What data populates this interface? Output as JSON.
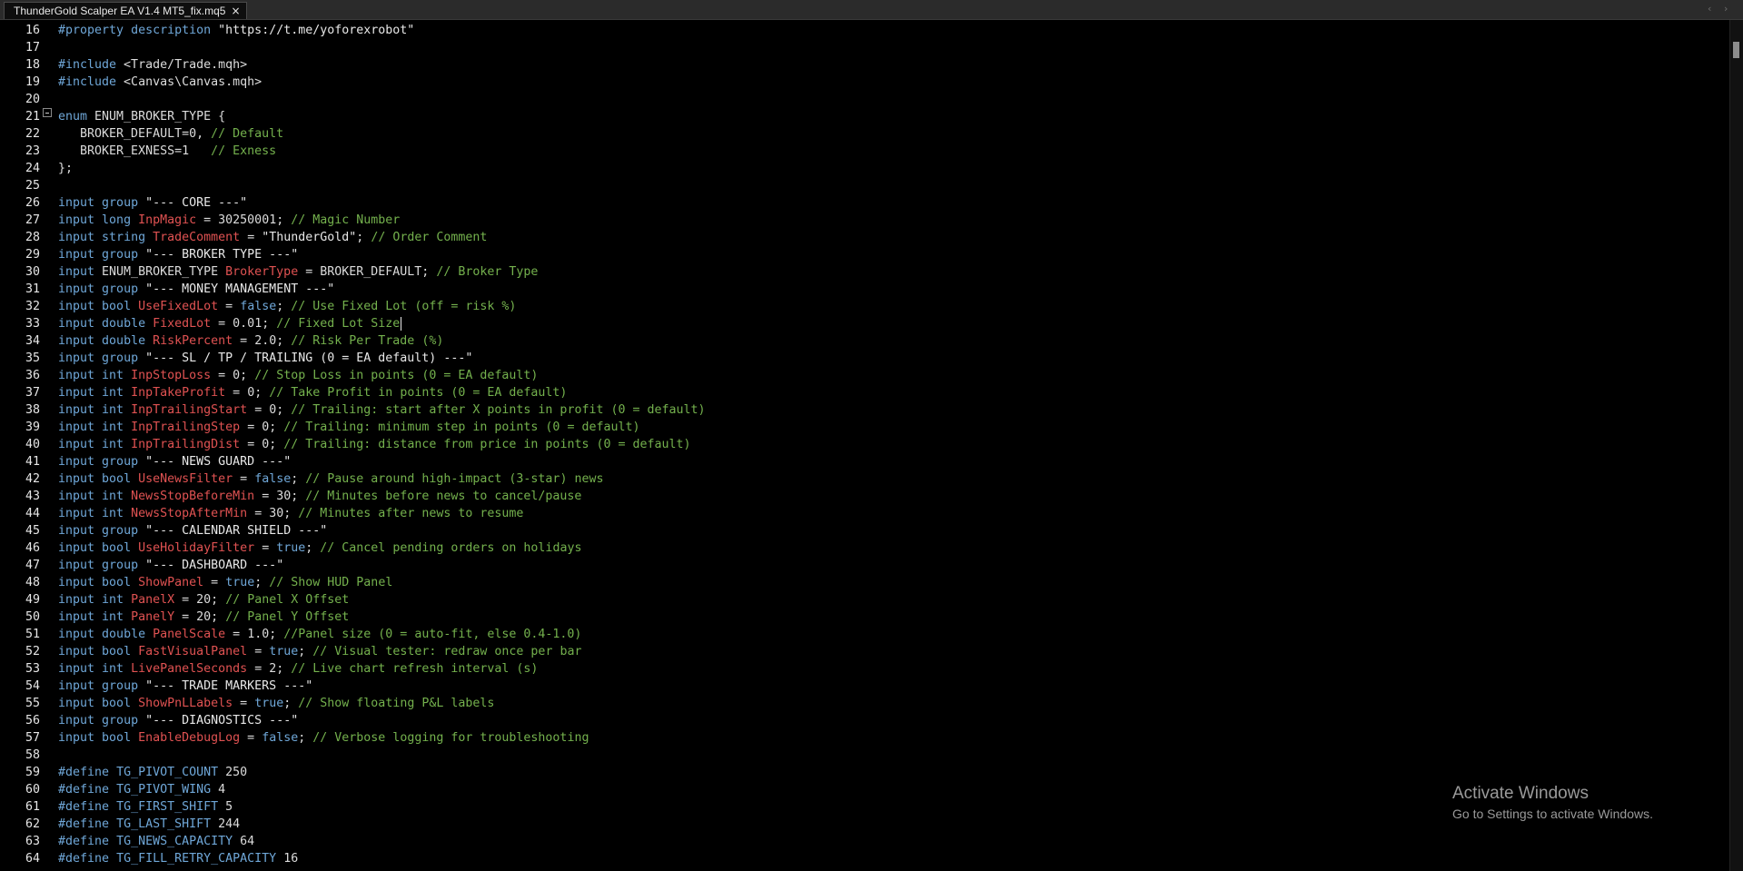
{
  "tab": {
    "title": "ThunderGold Scalper EA V1.4 MT5_fix.mq5",
    "close_icon": "×"
  },
  "nav": {
    "prev_icon": "‹",
    "next_icon": "›"
  },
  "watermark": {
    "title": "Activate Windows",
    "subtitle": "Go to Settings to activate Windows."
  },
  "code_lines": [
    {
      "n": "16",
      "t": [
        [
          "dir",
          "#property"
        ],
        [
          "pl",
          " "
        ],
        [
          "kw",
          "description"
        ],
        [
          "pl",
          " "
        ],
        [
          "str",
          "\"https://t.me/yoforexrobot\""
        ]
      ]
    },
    {
      "n": "17",
      "t": []
    },
    {
      "n": "18",
      "t": [
        [
          "dir",
          "#include"
        ],
        [
          "pl",
          " <Trade/Trade.mqh>"
        ]
      ]
    },
    {
      "n": "19",
      "t": [
        [
          "dir",
          "#include"
        ],
        [
          "pl",
          " <Canvas\\Canvas.mqh>"
        ]
      ]
    },
    {
      "n": "20",
      "t": []
    },
    {
      "n": "21",
      "t": [
        [
          "kw",
          "enum"
        ],
        [
          "pl",
          " ENUM_BROKER_TYPE {"
        ]
      ]
    },
    {
      "n": "22",
      "t": [
        [
          "pl",
          "   BROKER_DEFAULT=0, "
        ],
        [
          "cm",
          "// Default"
        ]
      ]
    },
    {
      "n": "23",
      "t": [
        [
          "pl",
          "   BROKER_EXNESS=1   "
        ],
        [
          "cm",
          "// Exness"
        ]
      ]
    },
    {
      "n": "24",
      "t": [
        [
          "pl",
          "};"
        ]
      ]
    },
    {
      "n": "25",
      "t": []
    },
    {
      "n": "26",
      "t": [
        [
          "kw",
          "input"
        ],
        [
          "pl",
          " "
        ],
        [
          "kw",
          "group"
        ],
        [
          "pl",
          " "
        ],
        [
          "str",
          "\"--- CORE ---\""
        ]
      ]
    },
    {
      "n": "27",
      "t": [
        [
          "kw",
          "input"
        ],
        [
          "pl",
          " "
        ],
        [
          "kw",
          "long"
        ],
        [
          "pl",
          " "
        ],
        [
          "var",
          "InpMagic"
        ],
        [
          "pl",
          " = 30250001; "
        ],
        [
          "cm",
          "// Magic Number"
        ]
      ]
    },
    {
      "n": "28",
      "t": [
        [
          "kw",
          "input"
        ],
        [
          "pl",
          " "
        ],
        [
          "kw",
          "string"
        ],
        [
          "pl",
          " "
        ],
        [
          "var",
          "TradeComment"
        ],
        [
          "pl",
          " = "
        ],
        [
          "str",
          "\"ThunderGold\""
        ],
        [
          "pl",
          "; "
        ],
        [
          "cm",
          "// Order Comment"
        ]
      ]
    },
    {
      "n": "29",
      "t": [
        [
          "kw",
          "input"
        ],
        [
          "pl",
          " "
        ],
        [
          "kw",
          "group"
        ],
        [
          "pl",
          " "
        ],
        [
          "str",
          "\"--- BROKER TYPE ---\""
        ]
      ]
    },
    {
      "n": "30",
      "t": [
        [
          "kw",
          "input"
        ],
        [
          "pl",
          " ENUM_BROKER_TYPE "
        ],
        [
          "var",
          "BrokerType"
        ],
        [
          "pl",
          " = BROKER_DEFAULT; "
        ],
        [
          "cm",
          "// Broker Type"
        ]
      ]
    },
    {
      "n": "31",
      "t": [
        [
          "kw",
          "input"
        ],
        [
          "pl",
          " "
        ],
        [
          "kw",
          "group"
        ],
        [
          "pl",
          " "
        ],
        [
          "str",
          "\"--- MONEY MANAGEMENT ---\""
        ]
      ]
    },
    {
      "n": "32",
      "t": [
        [
          "kw",
          "input"
        ],
        [
          "pl",
          " "
        ],
        [
          "kw",
          "bool"
        ],
        [
          "pl",
          " "
        ],
        [
          "var",
          "UseFixedLot"
        ],
        [
          "pl",
          " = "
        ],
        [
          "kw",
          "false"
        ],
        [
          "pl",
          "; "
        ],
        [
          "cm",
          "// Use Fixed Lot (off = risk %)"
        ]
      ]
    },
    {
      "n": "33",
      "t": [
        [
          "kw",
          "input"
        ],
        [
          "pl",
          " "
        ],
        [
          "kw",
          "double"
        ],
        [
          "pl",
          " "
        ],
        [
          "var",
          "FixedLot"
        ],
        [
          "pl",
          " = 0.01; "
        ],
        [
          "cm",
          "// Fixed Lot Size"
        ],
        [
          "caret",
          ""
        ]
      ]
    },
    {
      "n": "34",
      "t": [
        [
          "kw",
          "input"
        ],
        [
          "pl",
          " "
        ],
        [
          "kw",
          "double"
        ],
        [
          "pl",
          " "
        ],
        [
          "var",
          "RiskPercent"
        ],
        [
          "pl",
          " = 2.0; "
        ],
        [
          "cm",
          "// Risk Per Trade (%)"
        ]
      ]
    },
    {
      "n": "35",
      "t": [
        [
          "kw",
          "input"
        ],
        [
          "pl",
          " "
        ],
        [
          "kw",
          "group"
        ],
        [
          "pl",
          " "
        ],
        [
          "str",
          "\"--- SL / TP / TRAILING (0 = EA default) ---\""
        ]
      ]
    },
    {
      "n": "36",
      "t": [
        [
          "kw",
          "input"
        ],
        [
          "pl",
          " "
        ],
        [
          "kw",
          "int"
        ],
        [
          "pl",
          " "
        ],
        [
          "var",
          "InpStopLoss"
        ],
        [
          "pl",
          " = 0; "
        ],
        [
          "cm",
          "// Stop Loss in points (0 = EA default)"
        ]
      ]
    },
    {
      "n": "37",
      "t": [
        [
          "kw",
          "input"
        ],
        [
          "pl",
          " "
        ],
        [
          "kw",
          "int"
        ],
        [
          "pl",
          " "
        ],
        [
          "var",
          "InpTakeProfit"
        ],
        [
          "pl",
          " = 0; "
        ],
        [
          "cm",
          "// Take Profit in points (0 = EA default)"
        ]
      ]
    },
    {
      "n": "38",
      "t": [
        [
          "kw",
          "input"
        ],
        [
          "pl",
          " "
        ],
        [
          "kw",
          "int"
        ],
        [
          "pl",
          " "
        ],
        [
          "var",
          "InpTrailingStart"
        ],
        [
          "pl",
          " = 0; "
        ],
        [
          "cm",
          "// Trailing: start after X points in profit (0 = default)"
        ]
      ]
    },
    {
      "n": "39",
      "t": [
        [
          "kw",
          "input"
        ],
        [
          "pl",
          " "
        ],
        [
          "kw",
          "int"
        ],
        [
          "pl",
          " "
        ],
        [
          "var",
          "InpTrailingStep"
        ],
        [
          "pl",
          " = 0; "
        ],
        [
          "cm",
          "// Trailing: minimum step in points (0 = default)"
        ]
      ]
    },
    {
      "n": "40",
      "t": [
        [
          "kw",
          "input"
        ],
        [
          "pl",
          " "
        ],
        [
          "kw",
          "int"
        ],
        [
          "pl",
          " "
        ],
        [
          "var",
          "InpTrailingDist"
        ],
        [
          "pl",
          " = 0; "
        ],
        [
          "cm",
          "// Trailing: distance from price in points (0 = default)"
        ]
      ]
    },
    {
      "n": "41",
      "t": [
        [
          "kw",
          "input"
        ],
        [
          "pl",
          " "
        ],
        [
          "kw",
          "group"
        ],
        [
          "pl",
          " "
        ],
        [
          "str",
          "\"--- NEWS GUARD ---\""
        ]
      ]
    },
    {
      "n": "42",
      "t": [
        [
          "kw",
          "input"
        ],
        [
          "pl",
          " "
        ],
        [
          "kw",
          "bool"
        ],
        [
          "pl",
          " "
        ],
        [
          "var",
          "UseNewsFilter"
        ],
        [
          "pl",
          " = "
        ],
        [
          "kw",
          "false"
        ],
        [
          "pl",
          "; "
        ],
        [
          "cm",
          "// Pause around high-impact (3-star) news"
        ]
      ]
    },
    {
      "n": "43",
      "t": [
        [
          "kw",
          "input"
        ],
        [
          "pl",
          " "
        ],
        [
          "kw",
          "int"
        ],
        [
          "pl",
          " "
        ],
        [
          "var",
          "NewsStopBeforeMin"
        ],
        [
          "pl",
          " = 30; "
        ],
        [
          "cm",
          "// Minutes before news to cancel/pause"
        ]
      ]
    },
    {
      "n": "44",
      "t": [
        [
          "kw",
          "input"
        ],
        [
          "pl",
          " "
        ],
        [
          "kw",
          "int"
        ],
        [
          "pl",
          " "
        ],
        [
          "var",
          "NewsStopAfterMin"
        ],
        [
          "pl",
          " = 30; "
        ],
        [
          "cm",
          "// Minutes after news to resume"
        ]
      ]
    },
    {
      "n": "45",
      "t": [
        [
          "kw",
          "input"
        ],
        [
          "pl",
          " "
        ],
        [
          "kw",
          "group"
        ],
        [
          "pl",
          " "
        ],
        [
          "str",
          "\"--- CALENDAR SHIELD ---\""
        ]
      ]
    },
    {
      "n": "46",
      "t": [
        [
          "kw",
          "input"
        ],
        [
          "pl",
          " "
        ],
        [
          "kw",
          "bool"
        ],
        [
          "pl",
          " "
        ],
        [
          "var",
          "UseHolidayFilter"
        ],
        [
          "pl",
          " = "
        ],
        [
          "kw",
          "true"
        ],
        [
          "pl",
          "; "
        ],
        [
          "cm",
          "// Cancel pending orders on holidays"
        ]
      ]
    },
    {
      "n": "47",
      "t": [
        [
          "kw",
          "input"
        ],
        [
          "pl",
          " "
        ],
        [
          "kw",
          "group"
        ],
        [
          "pl",
          " "
        ],
        [
          "str",
          "\"--- DASHBOARD ---\""
        ]
      ]
    },
    {
      "n": "48",
      "t": [
        [
          "kw",
          "input"
        ],
        [
          "pl",
          " "
        ],
        [
          "kw",
          "bool"
        ],
        [
          "pl",
          " "
        ],
        [
          "var",
          "ShowPanel"
        ],
        [
          "pl",
          " = "
        ],
        [
          "kw",
          "true"
        ],
        [
          "pl",
          "; "
        ],
        [
          "cm",
          "// Show HUD Panel"
        ]
      ]
    },
    {
      "n": "49",
      "t": [
        [
          "kw",
          "input"
        ],
        [
          "pl",
          " "
        ],
        [
          "kw",
          "int"
        ],
        [
          "pl",
          " "
        ],
        [
          "var",
          "PanelX"
        ],
        [
          "pl",
          " = 20; "
        ],
        [
          "cm",
          "// Panel X Offset"
        ]
      ]
    },
    {
      "n": "50",
      "t": [
        [
          "kw",
          "input"
        ],
        [
          "pl",
          " "
        ],
        [
          "kw",
          "int"
        ],
        [
          "pl",
          " "
        ],
        [
          "var",
          "PanelY"
        ],
        [
          "pl",
          " = 20; "
        ],
        [
          "cm",
          "// Panel Y Offset"
        ]
      ]
    },
    {
      "n": "51",
      "t": [
        [
          "kw",
          "input"
        ],
        [
          "pl",
          " "
        ],
        [
          "kw",
          "double"
        ],
        [
          "pl",
          " "
        ],
        [
          "var",
          "PanelScale"
        ],
        [
          "pl",
          " = 1.0; "
        ],
        [
          "cm",
          "//Panel size (0 = auto-fit, else 0.4-1.0)"
        ]
      ]
    },
    {
      "n": "52",
      "t": [
        [
          "kw",
          "input"
        ],
        [
          "pl",
          " "
        ],
        [
          "kw",
          "bool"
        ],
        [
          "pl",
          " "
        ],
        [
          "var",
          "FastVisualPanel"
        ],
        [
          "pl",
          " = "
        ],
        [
          "kw",
          "true"
        ],
        [
          "pl",
          "; "
        ],
        [
          "cm",
          "// Visual tester: redraw once per bar"
        ]
      ]
    },
    {
      "n": "53",
      "t": [
        [
          "kw",
          "input"
        ],
        [
          "pl",
          " "
        ],
        [
          "kw",
          "int"
        ],
        [
          "pl",
          " "
        ],
        [
          "var",
          "LivePanelSeconds"
        ],
        [
          "pl",
          " = 2; "
        ],
        [
          "cm",
          "// Live chart refresh interval (s)"
        ]
      ]
    },
    {
      "n": "54",
      "t": [
        [
          "kw",
          "input"
        ],
        [
          "pl",
          " "
        ],
        [
          "kw",
          "group"
        ],
        [
          "pl",
          " "
        ],
        [
          "str",
          "\"--- TRADE MARKERS ---\""
        ]
      ]
    },
    {
      "n": "55",
      "t": [
        [
          "kw",
          "input"
        ],
        [
          "pl",
          " "
        ],
        [
          "kw",
          "bool"
        ],
        [
          "pl",
          " "
        ],
        [
          "var",
          "ShowPnLLabels"
        ],
        [
          "pl",
          " = "
        ],
        [
          "kw",
          "true"
        ],
        [
          "pl",
          "; "
        ],
        [
          "cm",
          "// Show floating P&L labels"
        ]
      ]
    },
    {
      "n": "56",
      "t": [
        [
          "kw",
          "input"
        ],
        [
          "pl",
          " "
        ],
        [
          "kw",
          "group"
        ],
        [
          "pl",
          " "
        ],
        [
          "str",
          "\"--- DIAGNOSTICS ---\""
        ]
      ]
    },
    {
      "n": "57",
      "t": [
        [
          "kw",
          "input"
        ],
        [
          "pl",
          " "
        ],
        [
          "kw",
          "bool"
        ],
        [
          "pl",
          " "
        ],
        [
          "var",
          "EnableDebugLog"
        ],
        [
          "pl",
          " = "
        ],
        [
          "kw",
          "false"
        ],
        [
          "pl",
          "; "
        ],
        [
          "cm",
          "// Verbose logging for troubleshooting"
        ]
      ]
    },
    {
      "n": "58",
      "t": []
    },
    {
      "n": "59",
      "t": [
        [
          "dir",
          "#define"
        ],
        [
          "pl",
          " "
        ],
        [
          "def",
          "TG_PIVOT_COUNT"
        ],
        [
          "pl",
          " 250"
        ]
      ]
    },
    {
      "n": "60",
      "t": [
        [
          "dir",
          "#define"
        ],
        [
          "pl",
          " "
        ],
        [
          "def",
          "TG_PIVOT_WING"
        ],
        [
          "pl",
          " 4"
        ]
      ]
    },
    {
      "n": "61",
      "t": [
        [
          "dir",
          "#define"
        ],
        [
          "pl",
          " "
        ],
        [
          "def",
          "TG_FIRST_SHIFT"
        ],
        [
          "pl",
          " 5"
        ]
      ]
    },
    {
      "n": "62",
      "t": [
        [
          "dir",
          "#define"
        ],
        [
          "pl",
          " "
        ],
        [
          "def",
          "TG_LAST_SHIFT"
        ],
        [
          "pl",
          " 244"
        ]
      ]
    },
    {
      "n": "63",
      "t": [
        [
          "dir",
          "#define"
        ],
        [
          "pl",
          " "
        ],
        [
          "def",
          "TG_NEWS_CAPACITY"
        ],
        [
          "pl",
          " 64"
        ]
      ]
    },
    {
      "n": "64",
      "t": [
        [
          "dir",
          "#define"
        ],
        [
          "pl",
          " "
        ],
        [
          "def",
          "TG_FILL_RETRY_CAPACITY"
        ],
        [
          "pl",
          " 16"
        ]
      ]
    }
  ]
}
